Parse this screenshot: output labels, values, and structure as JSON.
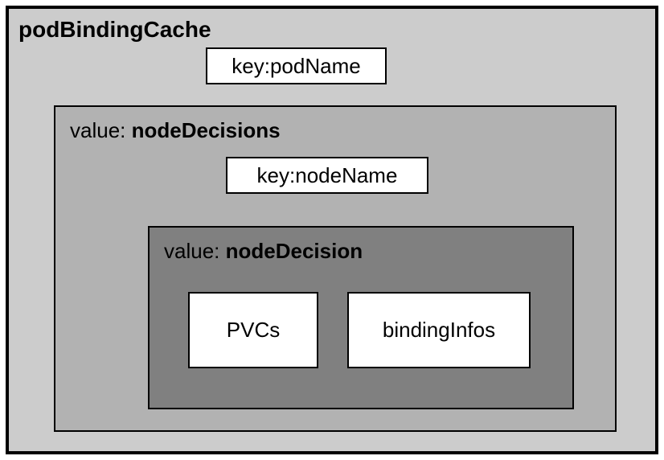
{
  "outer": {
    "title": "podBindingCache",
    "key_prefix": "key: ",
    "key_value": "podName"
  },
  "middle": {
    "value_prefix": "value: ",
    "value_name": "nodeDecisions",
    "key_prefix": "key: ",
    "key_value": "nodeName"
  },
  "inner": {
    "value_prefix": "value: ",
    "value_name": "nodeDecision",
    "box1": "PVCs",
    "box2": "bindingInfos"
  }
}
